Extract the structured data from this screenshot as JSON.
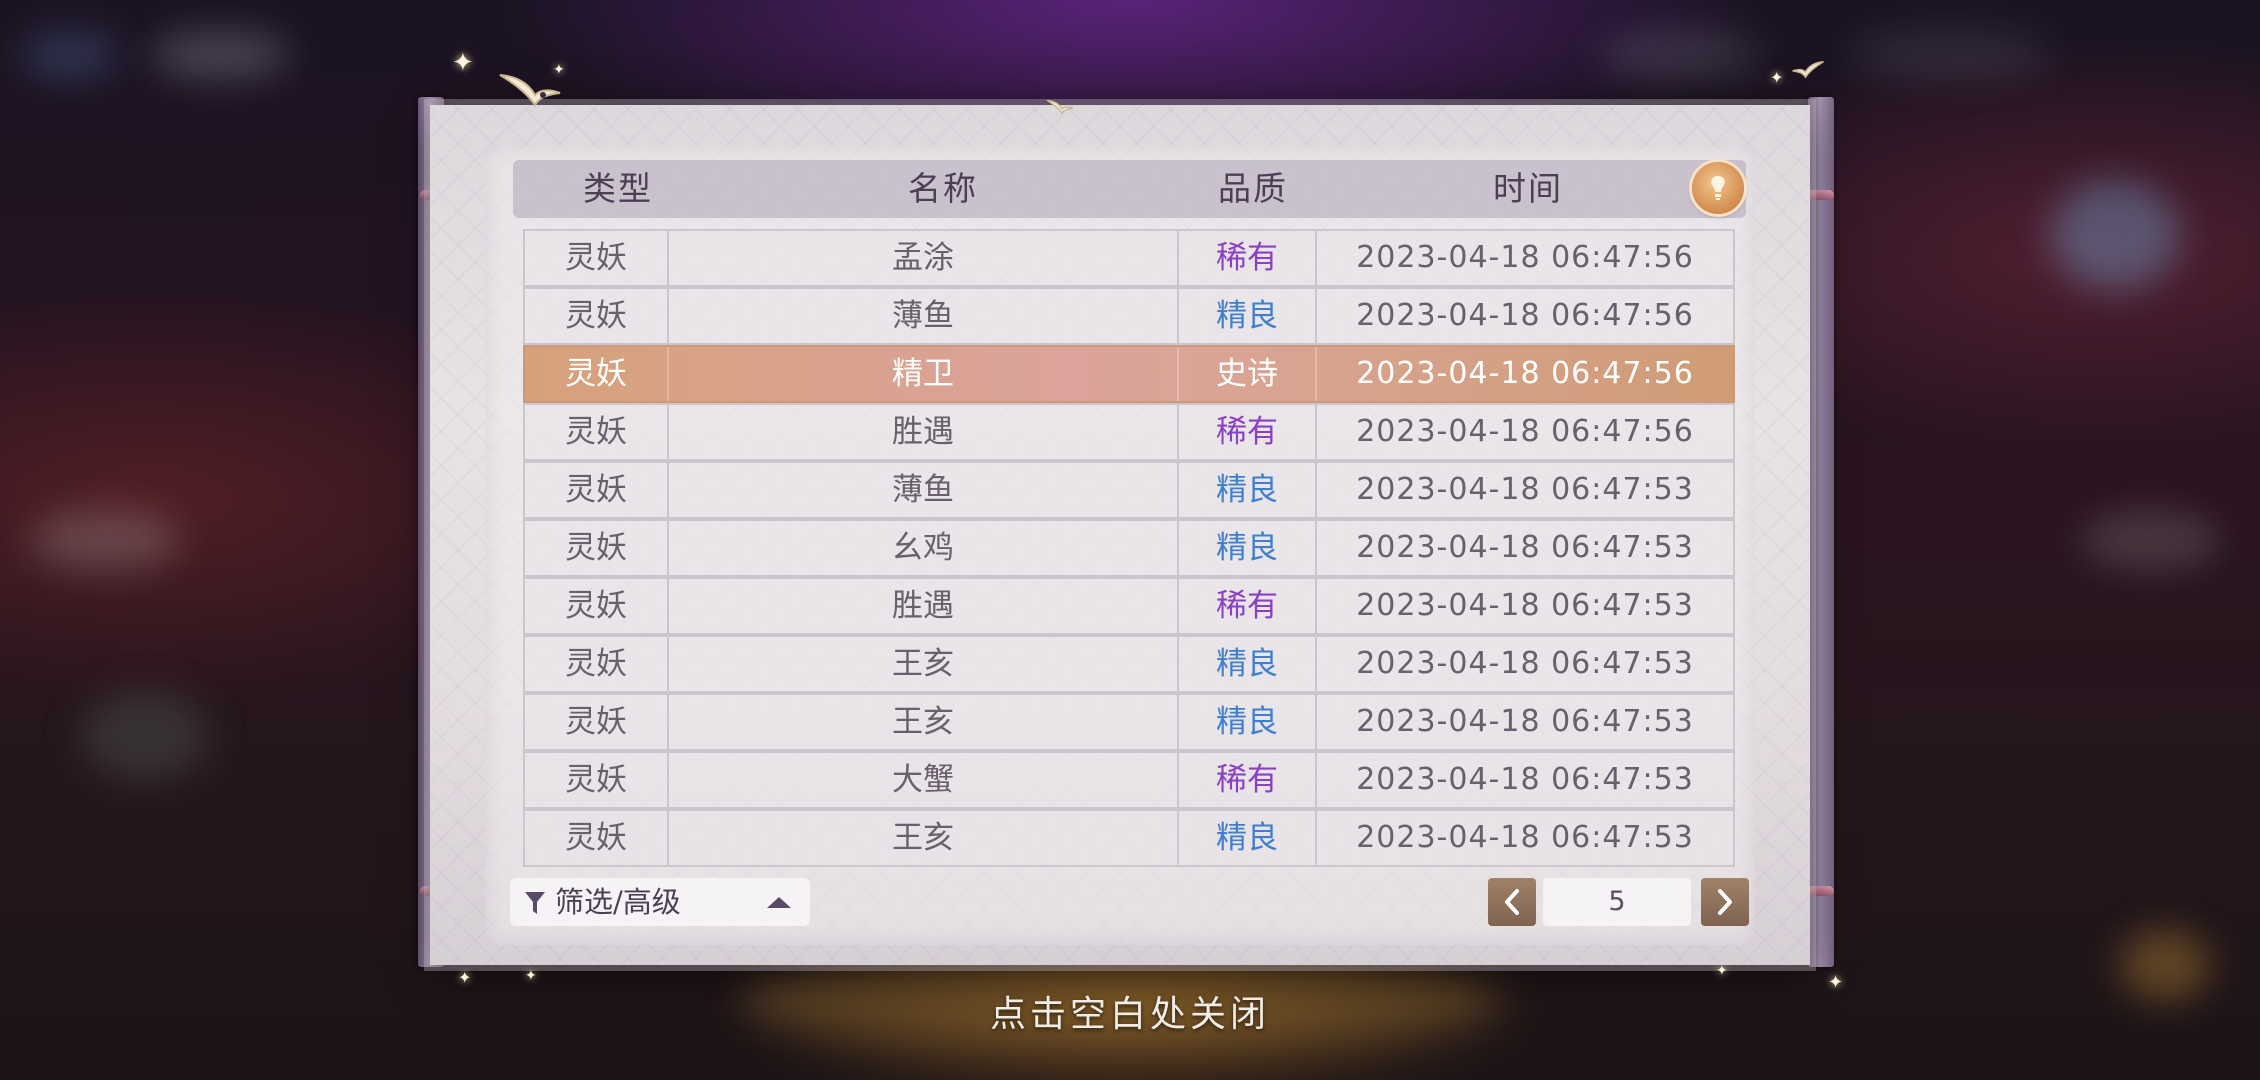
{
  "table": {
    "headers": {
      "type": "类型",
      "name": "名称",
      "quality": "品质",
      "time": "时间"
    },
    "rows": [
      {
        "type": "灵妖",
        "name": "孟涂",
        "quality": "稀有",
        "quality_class": "rare",
        "time": "2023-04-18  06:47:56",
        "selected": false
      },
      {
        "type": "灵妖",
        "name": "薄鱼",
        "quality": "精良",
        "quality_class": "good",
        "time": "2023-04-18  06:47:56",
        "selected": false
      },
      {
        "type": "灵妖",
        "name": "精卫",
        "quality": "史诗",
        "quality_class": "epic",
        "time": "2023-04-18  06:47:56",
        "selected": true
      },
      {
        "type": "灵妖",
        "name": "胜遇",
        "quality": "稀有",
        "quality_class": "rare",
        "time": "2023-04-18  06:47:56",
        "selected": false
      },
      {
        "type": "灵妖",
        "name": "薄鱼",
        "quality": "精良",
        "quality_class": "good",
        "time": "2023-04-18  06:47:53",
        "selected": false
      },
      {
        "type": "灵妖",
        "name": "幺鸡",
        "quality": "精良",
        "quality_class": "good",
        "time": "2023-04-18  06:47:53",
        "selected": false
      },
      {
        "type": "灵妖",
        "name": "胜遇",
        "quality": "稀有",
        "quality_class": "rare",
        "time": "2023-04-18  06:47:53",
        "selected": false
      },
      {
        "type": "灵妖",
        "name": "王亥",
        "quality": "精良",
        "quality_class": "good",
        "time": "2023-04-18  06:47:53",
        "selected": false
      },
      {
        "type": "灵妖",
        "name": "王亥",
        "quality": "精良",
        "quality_class": "good",
        "time": "2023-04-18  06:47:53",
        "selected": false
      },
      {
        "type": "灵妖",
        "name": "大蟹",
        "quality": "稀有",
        "quality_class": "rare",
        "time": "2023-04-18  06:47:53",
        "selected": false
      },
      {
        "type": "灵妖",
        "name": "王亥",
        "quality": "精良",
        "quality_class": "good",
        "time": "2023-04-18  06:47:53",
        "selected": false
      }
    ]
  },
  "filter": {
    "label": "筛选/高级",
    "icon": "filter-icon",
    "toggle_icon": "chevron-up-icon"
  },
  "pagination": {
    "current_page": "5",
    "prev_icon": "chevron-left-icon",
    "next_icon": "chevron-right-icon"
  },
  "info_button": {
    "icon": "lightbulb-icon"
  },
  "close_hint": "点击空白处关闭",
  "colors": {
    "rare": "#8a3fc7",
    "good": "#3f7fcf",
    "selected_row": "#d9a493"
  }
}
